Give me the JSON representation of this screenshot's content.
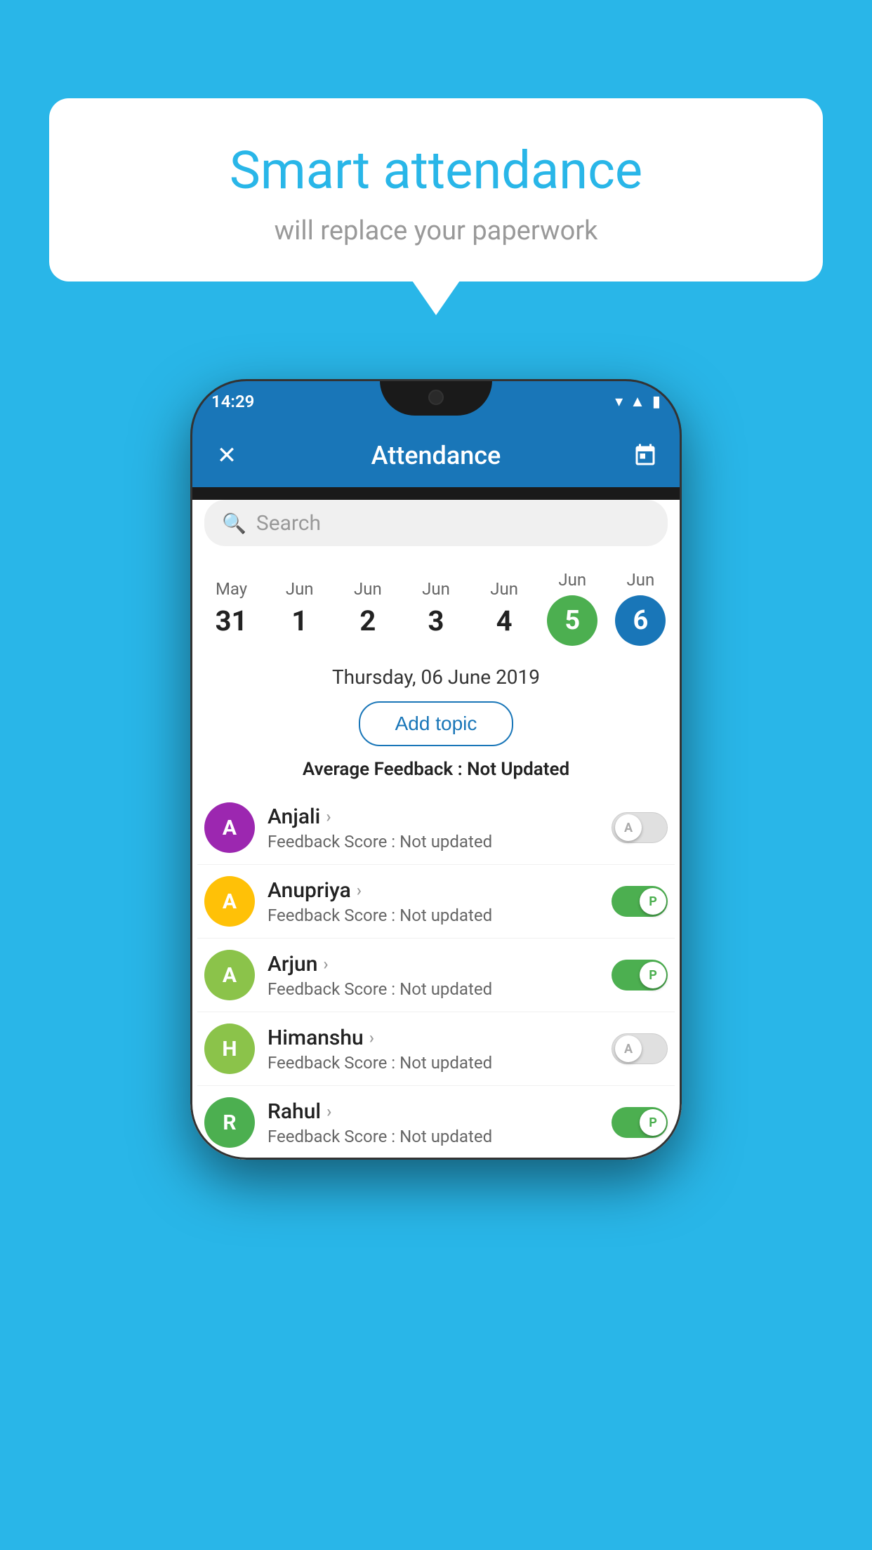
{
  "background_color": "#29B6E8",
  "bubble": {
    "title": "Smart attendance",
    "subtitle": "will replace your paperwork"
  },
  "phone": {
    "status_bar": {
      "time": "14:29",
      "wifi": "▾",
      "signal": "▲",
      "battery": "▮"
    },
    "app_bar": {
      "title": "Attendance",
      "close_icon": "✕",
      "calendar_icon": "📅"
    },
    "search": {
      "placeholder": "Search"
    },
    "dates": [
      {
        "month": "May",
        "day": "31",
        "state": "normal"
      },
      {
        "month": "Jun",
        "day": "1",
        "state": "normal"
      },
      {
        "month": "Jun",
        "day": "2",
        "state": "normal"
      },
      {
        "month": "Jun",
        "day": "3",
        "state": "normal"
      },
      {
        "month": "Jun",
        "day": "4",
        "state": "normal"
      },
      {
        "month": "Jun",
        "day": "5",
        "state": "today"
      },
      {
        "month": "Jun",
        "day": "6",
        "state": "selected"
      }
    ],
    "selected_date_label": "Thursday, 06 June 2019",
    "add_topic_label": "Add topic",
    "avg_feedback_label": "Average Feedback : ",
    "avg_feedback_value": "Not Updated",
    "students": [
      {
        "name": "Anjali",
        "avatar_letter": "A",
        "avatar_color": "#9C27B0",
        "feedback_label": "Feedback Score : ",
        "feedback_value": "Not updated",
        "toggle_state": "off",
        "toggle_label": "A"
      },
      {
        "name": "Anupriya",
        "avatar_letter": "A",
        "avatar_color": "#FFC107",
        "feedback_label": "Feedback Score : ",
        "feedback_value": "Not updated",
        "toggle_state": "on",
        "toggle_label": "P"
      },
      {
        "name": "Arjun",
        "avatar_letter": "A",
        "avatar_color": "#8BC34A",
        "feedback_label": "Feedback Score : ",
        "feedback_value": "Not updated",
        "toggle_state": "on",
        "toggle_label": "P"
      },
      {
        "name": "Himanshu",
        "avatar_letter": "H",
        "avatar_color": "#8BC34A",
        "feedback_label": "Feedback Score : ",
        "feedback_value": "Not updated",
        "toggle_state": "off",
        "toggle_label": "A"
      },
      {
        "name": "Rahul",
        "avatar_letter": "R",
        "avatar_color": "#4CAF50",
        "feedback_label": "Feedback Score : ",
        "feedback_value": "Not updated",
        "toggle_state": "on",
        "toggle_label": "P"
      }
    ]
  }
}
